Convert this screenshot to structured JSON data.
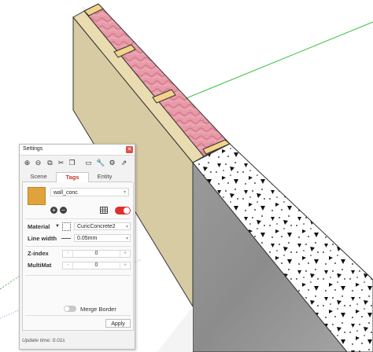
{
  "panel": {
    "title": "Settings",
    "close_glyph": "✕",
    "toolbar": [
      {
        "icon": "add-circle-icon",
        "glyph": "⊕"
      },
      {
        "icon": "remove-circle-icon",
        "glyph": "⊖"
      },
      {
        "icon": "copy-icon",
        "glyph": "⧉"
      },
      {
        "icon": "cut-icon",
        "glyph": "✂"
      },
      {
        "icon": "paste-icon",
        "glyph": "❐"
      },
      {
        "icon": "monitor-icon",
        "glyph": "▭"
      },
      {
        "icon": "wrench-icon",
        "glyph": "🔧"
      },
      {
        "icon": "gears-icon",
        "glyph": "⚙"
      },
      {
        "icon": "export-icon",
        "glyph": "⇗"
      }
    ],
    "tabs": [
      {
        "label": "Scene",
        "active": false
      },
      {
        "label": "Tags",
        "active": true
      },
      {
        "label": "Entity",
        "active": false
      }
    ],
    "tag": {
      "name": "wall_conc",
      "color": "#e0a33b",
      "visible": true
    },
    "fields": {
      "material_label": "Material",
      "material_value": "CuricConcrete2",
      "line_width_label": "Line width",
      "line_width_value": "0.05mm",
      "zindex_label": "Z-index",
      "zindex_value": "0",
      "multimat_label": "MultiMat",
      "multimat_value": "0",
      "minus": "-",
      "plus": "+"
    },
    "merge_border_label": "Merge Border",
    "merge_border_on": false,
    "apply_label": "Apply",
    "footer": "Update time: 0.01s"
  },
  "colors": {
    "accent": "#e02d2d",
    "tag_active": "#c0392b"
  }
}
